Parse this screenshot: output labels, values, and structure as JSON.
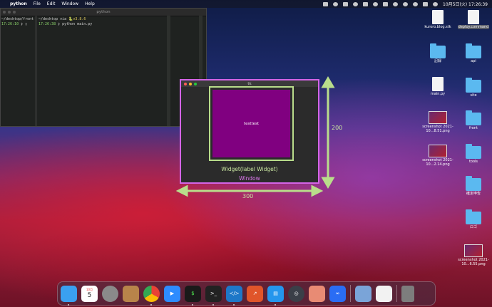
{
  "menubar": {
    "app": "python",
    "items": [
      "File",
      "Edit",
      "Window",
      "Help"
    ],
    "datetime": "10月5日(火) 17:26:39"
  },
  "terminal": {
    "title": "python",
    "left_prompt": "~/desktop/front",
    "left_time": "17:26:10",
    "right_path": "~/desktop via",
    "right_env": "🐍v3.8.6",
    "right_time": "17:26:38",
    "right_cmd": "python main.py"
  },
  "tk_window": {
    "title": "tk",
    "label_text": "testtest",
    "label_bg": "#800080",
    "caption_widget": "Widget(label Widget)",
    "caption_window": "Window",
    "width_label": "300",
    "height_label": "200"
  },
  "desktop": {
    "icons": [
      {
        "label": "kuroro.blog.stk",
        "kind": "doc"
      },
      {
        "label": "deploy.command",
        "kind": "doc",
        "selected": true
      },
      {
        "label": "記録",
        "kind": "folder"
      },
      {
        "label": "api",
        "kind": "folder"
      },
      {
        "label": "main.py",
        "kind": "doc"
      },
      {
        "label": "site",
        "kind": "folder"
      },
      {
        "label": "screenshot 2021-10...8.51.png",
        "kind": "shot"
      },
      {
        "label": "front",
        "kind": "folder"
      },
      {
        "label": "screenshot 2021-10...2.14.png",
        "kind": "shot"
      },
      {
        "label": "tools",
        "kind": "folder"
      },
      {
        "label": "確定申告",
        "kind": "folder"
      },
      {
        "label": "ロゴ",
        "kind": "folder"
      },
      {
        "label": "screenshot 2021-10...6.55.png",
        "kind": "shot"
      }
    ]
  },
  "dock": {
    "apps": [
      {
        "name": "Finder",
        "icon": "finder-icon",
        "color": "#3aa0f0"
      },
      {
        "name": "Calendar",
        "icon": "calendar-icon",
        "color": "#ffffff",
        "text": "5"
      },
      {
        "name": "System Preferences",
        "icon": "settings-icon",
        "color": "#8a8a8a"
      },
      {
        "name": "Contacts",
        "icon": "contacts-icon",
        "color": "#b8844a"
      },
      {
        "name": "Chrome",
        "icon": "chrome-icon",
        "color": "#e94235"
      },
      {
        "name": "Zoom",
        "icon": "zoom-icon",
        "color": "#2d8cff"
      },
      {
        "name": "iTerm",
        "icon": "iterm-icon",
        "color": "#1a1a1a",
        "text": "$"
      },
      {
        "name": "Terminal",
        "icon": "terminal-icon",
        "color": "#222222",
        "text": ">_"
      },
      {
        "name": "VS Code",
        "icon": "vscode-icon",
        "color": "#1e78c8"
      },
      {
        "name": "Stats",
        "icon": "chart-app-icon",
        "color": "#e0552a"
      },
      {
        "name": "Docker",
        "icon": "docker-icon",
        "color": "#2496ed"
      },
      {
        "name": "Proxyman",
        "icon": "proxyman-icon",
        "color": "#3a3f48"
      },
      {
        "name": "Preview",
        "icon": "preview-icon",
        "color": "#e88b74"
      },
      {
        "name": "Infinity",
        "icon": "infinity-icon",
        "color": "#2a6df4"
      },
      {
        "name": "Photos",
        "icon": "image-icon",
        "color": "#7aa4d8"
      },
      {
        "name": "Document",
        "icon": "document-icon",
        "color": "#f2f2f2"
      },
      {
        "name": "Trash",
        "icon": "trash-icon",
        "color": "#7d7d7d"
      }
    ],
    "calendar_month": "10月"
  }
}
